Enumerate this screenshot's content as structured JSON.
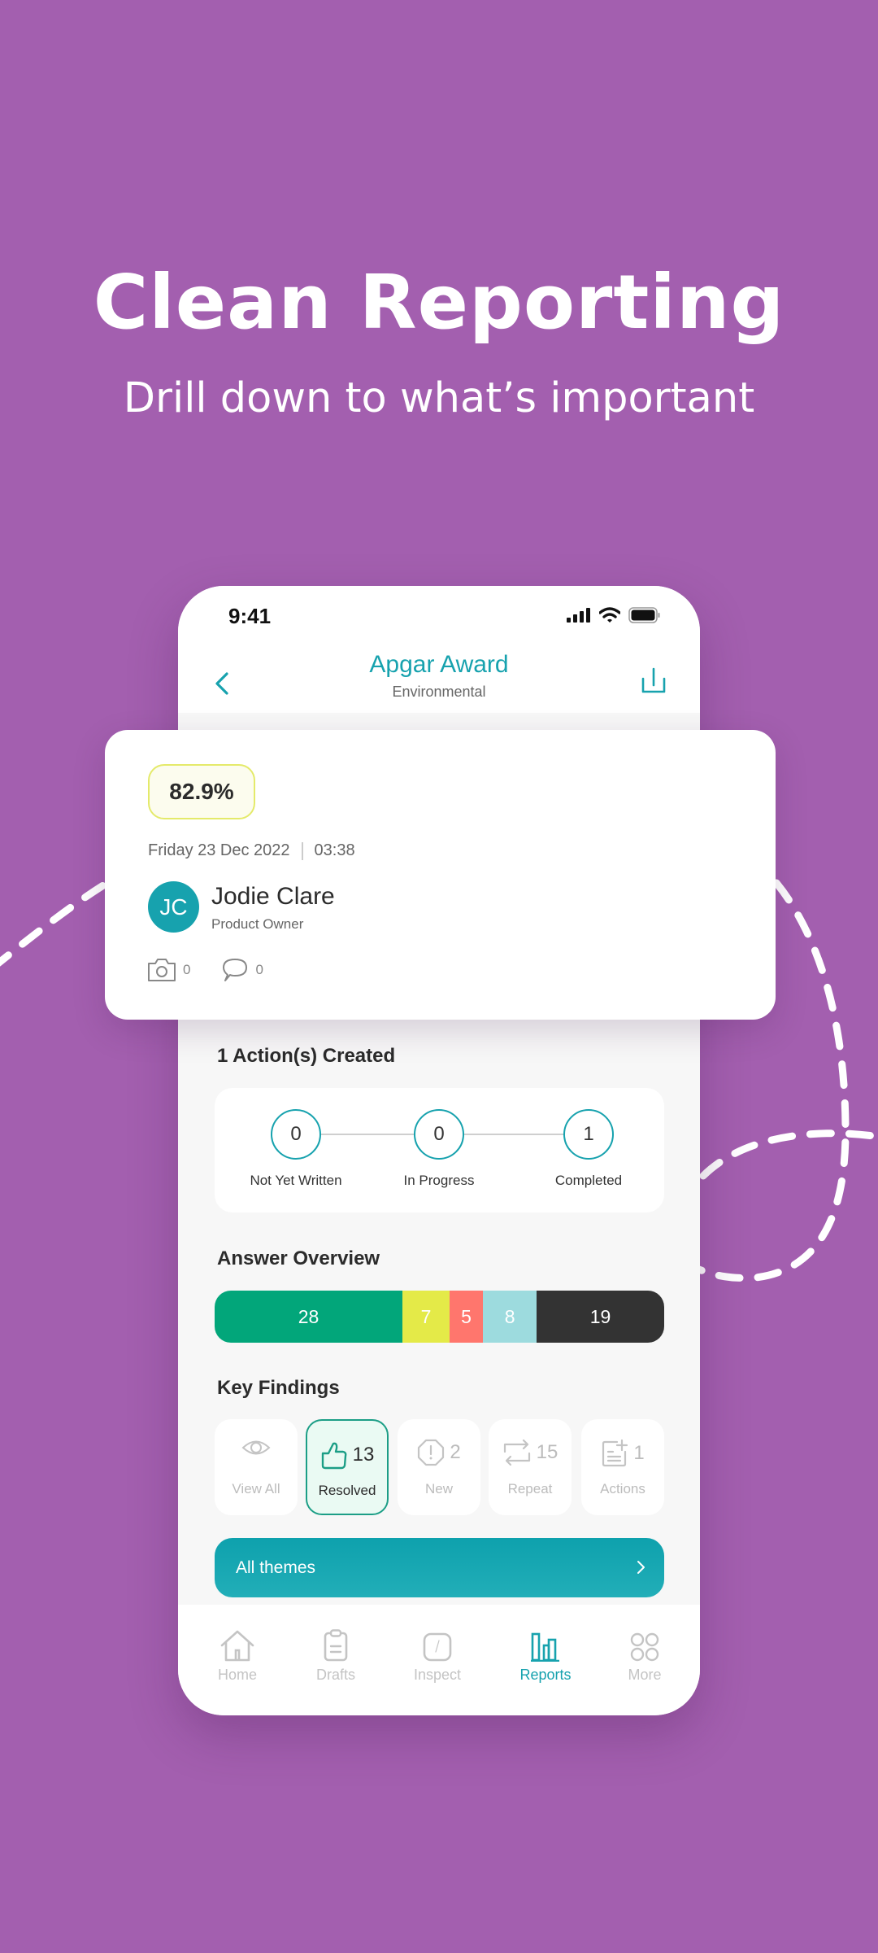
{
  "hero": {
    "title": "Clean Reporting",
    "subtitle": "Drill down to what’s important"
  },
  "colors": {
    "background": "#A35FAF",
    "accent": "#17A2AE",
    "resolved_accent": "#1C9E86"
  },
  "status_bar": {
    "time": "9:41",
    "icons": [
      "cellular-signal-icon",
      "wifi-icon",
      "battery-icon"
    ]
  },
  "header": {
    "title": "Apgar Award",
    "subtitle": "Environmental",
    "back_icon": "chevron-left-icon",
    "share_icon": "share-icon"
  },
  "summary": {
    "score": "82.9%",
    "date": "Friday 23 Dec 2022",
    "time": "03:38",
    "user": {
      "initials": "JC",
      "name": "Jodie Clare",
      "role": "Product Owner"
    },
    "photos_count": "0",
    "comments_count": "0"
  },
  "actions": {
    "title": "1 Action(s) Created",
    "steps": [
      {
        "label": "Not Yet Written",
        "count": "0"
      },
      {
        "label": "In Progress",
        "count": "0"
      },
      {
        "label": "Completed",
        "count": "1"
      }
    ]
  },
  "answer_overview": {
    "title": "Answer Overview",
    "segments": [
      {
        "value": 28,
        "color": "#02A67A"
      },
      {
        "value": 7,
        "color": "#E4EA48"
      },
      {
        "value": 5,
        "color": "#FF766D"
      },
      {
        "value": 8,
        "color": "#9DDBDE"
      },
      {
        "value": 19,
        "color": "#333333"
      }
    ]
  },
  "key_findings": {
    "title": "Key Findings",
    "items": [
      {
        "label": "View All",
        "count": "",
        "icon": "eye-icon",
        "active": false
      },
      {
        "label": "Resolved",
        "count": "13",
        "icon": "thumbs-up-icon",
        "active": true
      },
      {
        "label": "New",
        "count": "2",
        "icon": "alert-octagon-icon",
        "active": false
      },
      {
        "label": "Repeat",
        "count": "15",
        "icon": "repeat-icon",
        "active": false
      },
      {
        "label": "Actions",
        "count": "1",
        "icon": "add-note-icon",
        "active": false
      }
    ]
  },
  "themes_button": {
    "label": "All themes"
  },
  "tab_bar": {
    "items": [
      {
        "label": "Home",
        "icon": "home-icon",
        "active": false
      },
      {
        "label": "Drafts",
        "icon": "clipboard-icon",
        "active": false
      },
      {
        "label": "Inspect",
        "icon": "inspect-icon",
        "active": false
      },
      {
        "label": "Reports",
        "icon": "bar-chart-icon",
        "active": true
      },
      {
        "label": "More",
        "icon": "grid-icon",
        "active": false
      }
    ]
  }
}
